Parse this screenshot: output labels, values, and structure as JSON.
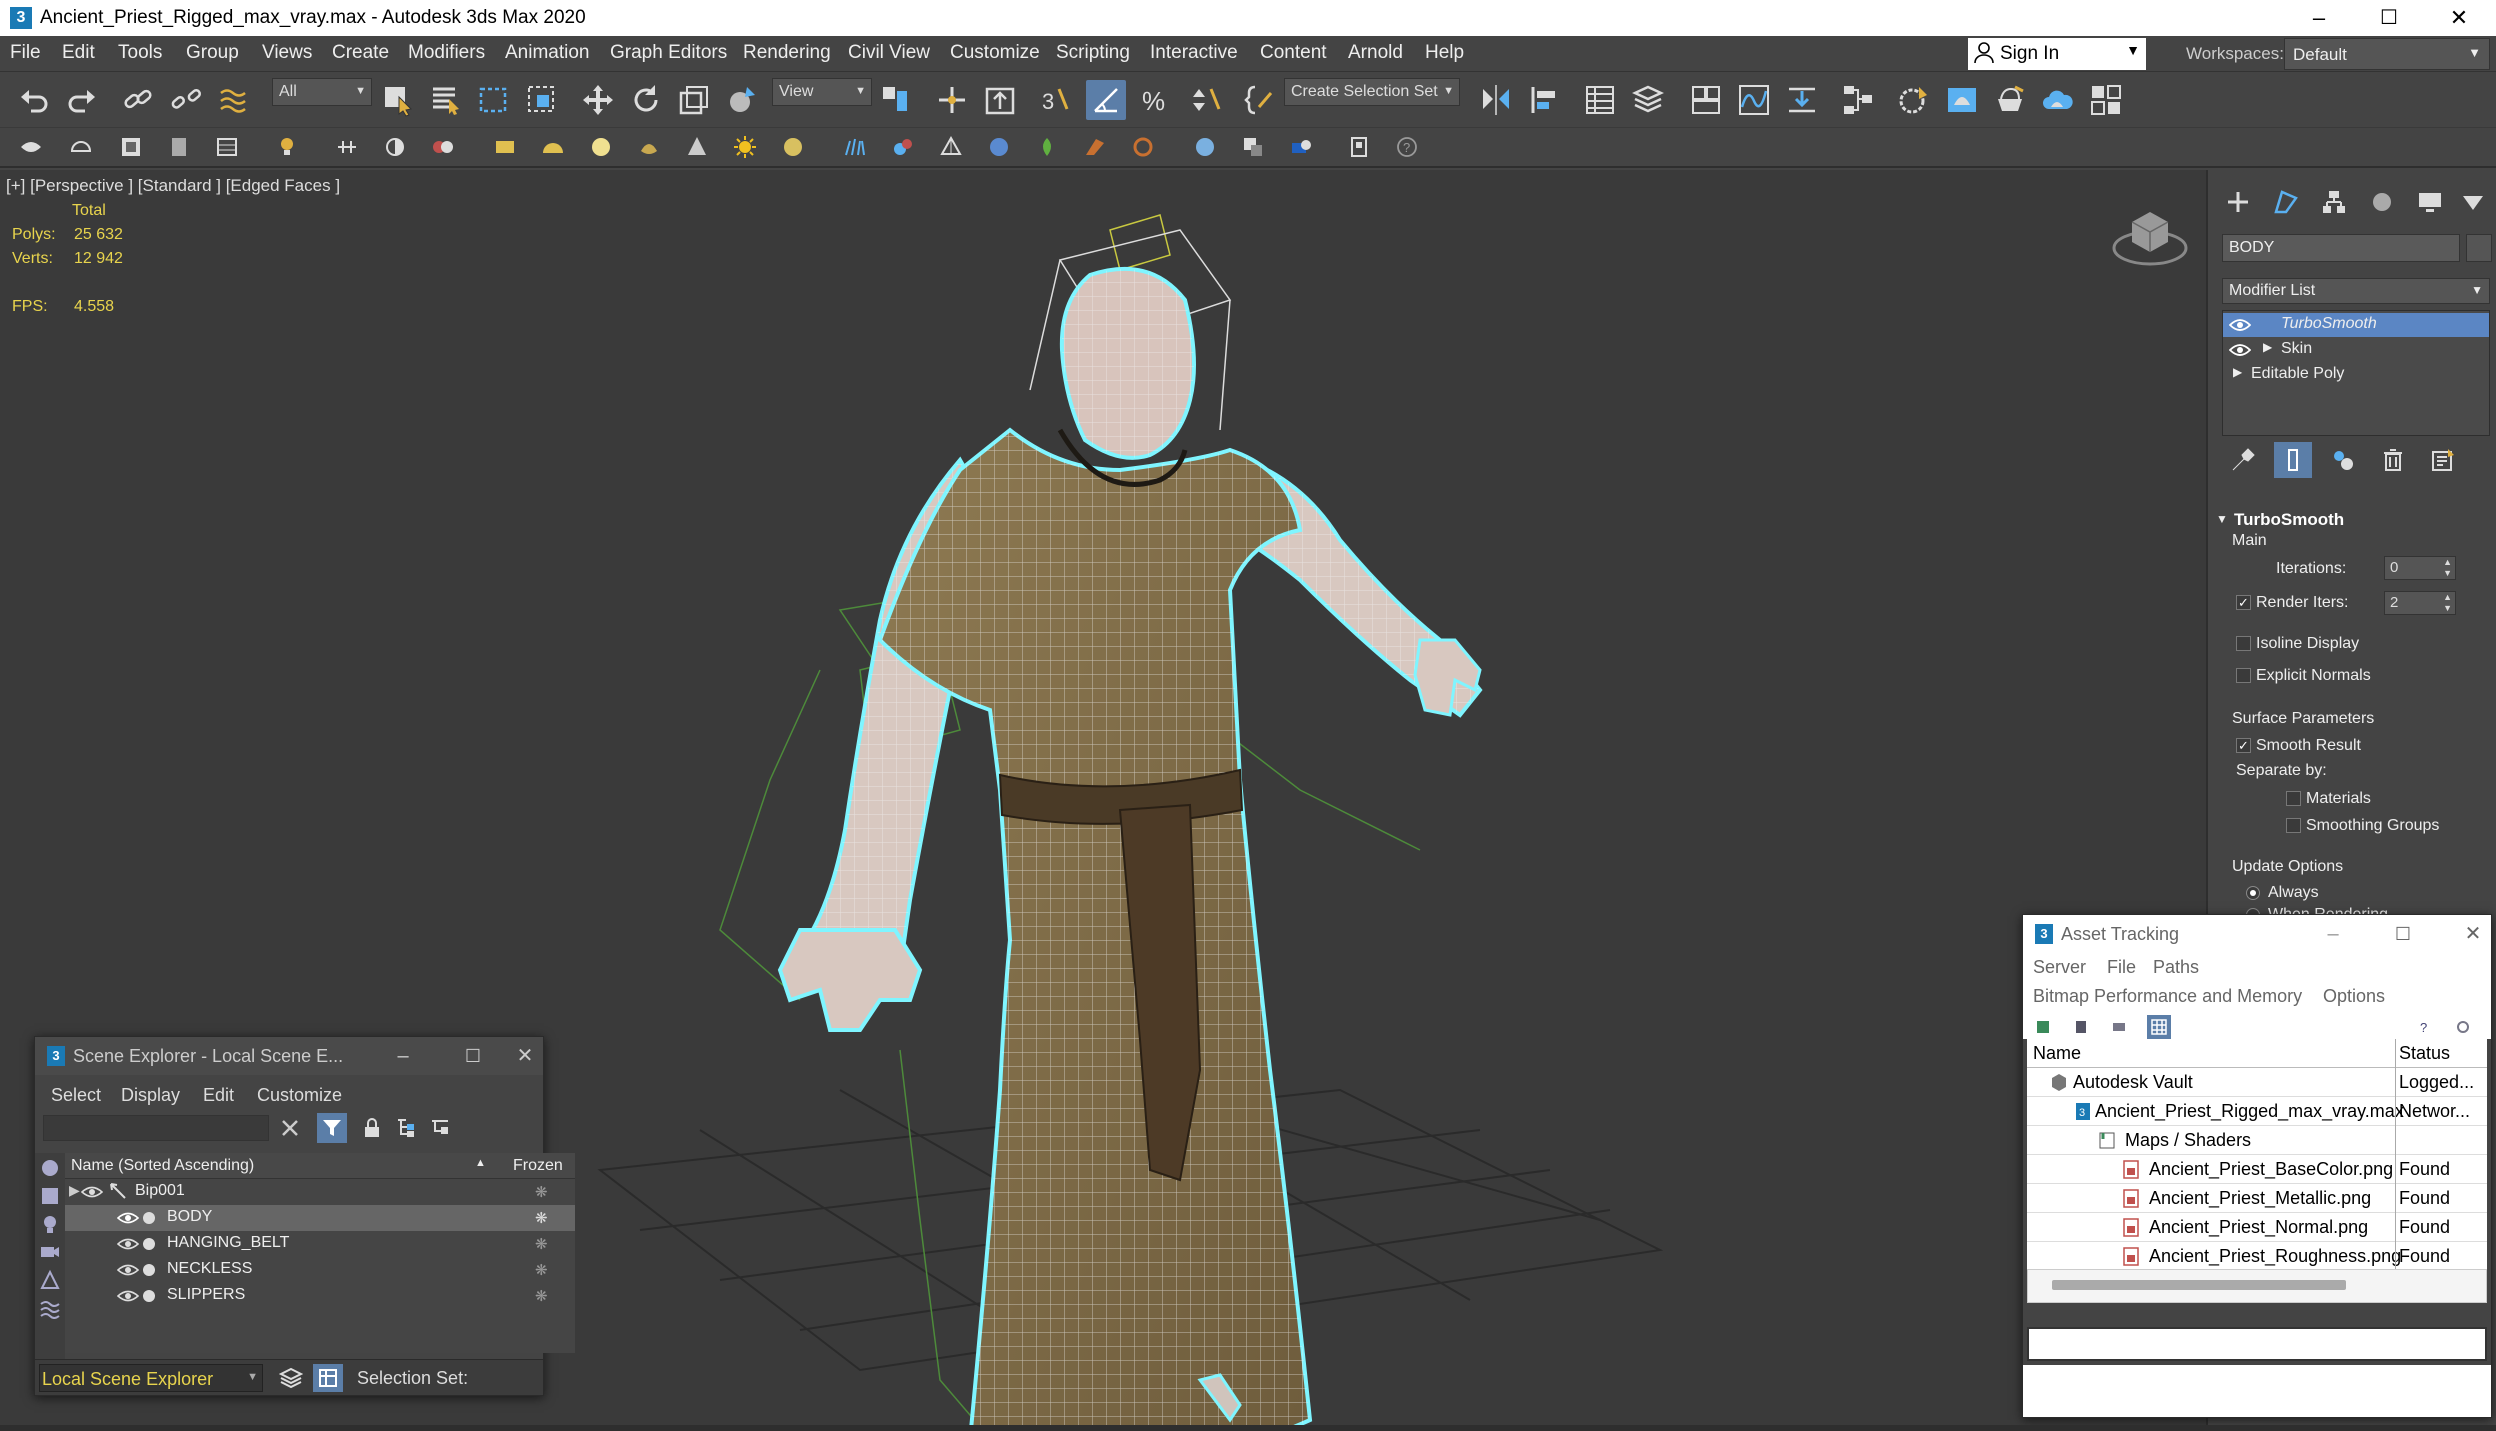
{
  "window": {
    "title": "Ancient_Priest_Rigged_max_vray.max - Autodesk 3ds Max 2020",
    "app_icon": "3",
    "minimize": "–",
    "maximize": "☐",
    "close": "✕"
  },
  "menu": [
    "File",
    "Edit",
    "Tools",
    "Group",
    "Views",
    "Create",
    "Modifiers",
    "Animation",
    "Graph Editors",
    "Rendering",
    "Civil View",
    "Customize",
    "Scripting",
    "Interactive",
    "Content",
    "Arnold",
    "Help"
  ],
  "sign_in": "Sign In",
  "workspaces": {
    "label": "Workspaces:",
    "value": "Default"
  },
  "toolbar": {
    "selection_filter": "All",
    "ref_coord": "View",
    "named_selection": "Create Selection Set"
  },
  "viewport": {
    "label": "[+] [Perspective ] [Standard ] [Edged Faces ]",
    "stats": {
      "total_label": "Total",
      "polys_label": "Polys:",
      "polys": "25 632",
      "verts_label": "Verts:",
      "verts": "12 942",
      "fps_label": "FPS:",
      "fps": "4.558"
    }
  },
  "command_panel": {
    "object_name": "BODY",
    "modifier_list": "Modifier List",
    "stack": [
      {
        "label": "TurboSmooth",
        "selected": true
      },
      {
        "label": "Skin",
        "selected": false
      },
      {
        "label": "Editable Poly",
        "selected": false
      }
    ],
    "rollout": {
      "title": "TurboSmooth",
      "main": "Main",
      "iterations_label": "Iterations:",
      "iterations": "0",
      "render_iters_label": "Render Iters:",
      "render_iters": "2",
      "isoline": "Isoline Display",
      "explicit_normals": "Explicit Normals",
      "surface_params": "Surface Parameters",
      "smooth_result": "Smooth Result",
      "separate_by": "Separate by:",
      "materials": "Materials",
      "smoothing_groups": "Smoothing Groups",
      "update_options": "Update Options",
      "always": "Always",
      "when_rendering": "When Rendering"
    }
  },
  "scene_explorer": {
    "title": "Scene Explorer - Local Scene E...",
    "menu": [
      "Select",
      "Display",
      "Edit",
      "Customize"
    ],
    "col_name": "Name (Sorted Ascending)",
    "col_frozen": "Frozen",
    "rows": [
      {
        "label": "Bip001",
        "selected": false
      },
      {
        "label": "BODY",
        "selected": true
      },
      {
        "label": "HANGING_BELT",
        "selected": false
      },
      {
        "label": "NECKLESS",
        "selected": false
      },
      {
        "label": "SLIPPERS",
        "selected": false
      }
    ],
    "footer_name": "Local Scene Explorer",
    "selection_set": "Selection Set:"
  },
  "asset_tracking": {
    "title": "Asset Tracking",
    "menu1": [
      "Server",
      "File",
      "Paths"
    ],
    "menu2": [
      "Bitmap Performance and Memory",
      "Options"
    ],
    "col_name": "Name",
    "col_status": "Status",
    "rows": [
      {
        "name": "Autodesk Vault",
        "status": "Logged..."
      },
      {
        "name": "Ancient_Priest_Rigged_max_vray.max",
        "status": "Networ..."
      },
      {
        "name": "Maps / Shaders",
        "status": ""
      },
      {
        "name": "Ancient_Priest_BaseColor.png",
        "status": "Found"
      },
      {
        "name": "Ancient_Priest_Metallic.png",
        "status": "Found"
      },
      {
        "name": "Ancient_Priest_Normal.png",
        "status": "Found"
      },
      {
        "name": "Ancient_Priest_Roughness.png",
        "status": "Found"
      }
    ]
  },
  "colors": {
    "accent": "#5b86c4",
    "stats_yellow": "#e8d44d",
    "viewport_bg": "#3a3a3a",
    "selection_cyan": "#7ff5ff"
  }
}
